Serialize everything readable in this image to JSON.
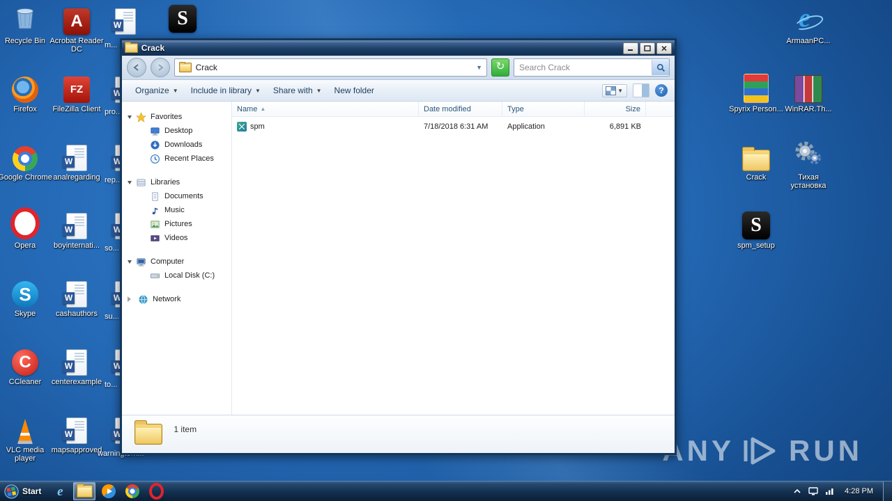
{
  "desktop": {
    "column1": [
      {
        "label": "Recycle Bin"
      },
      {
        "label": "Firefox"
      },
      {
        "label": "Google Chrome"
      },
      {
        "label": "Opera"
      },
      {
        "label": "Skype"
      },
      {
        "label": "CCleaner"
      },
      {
        "label": "VLC media player"
      }
    ],
    "column2": [
      {
        "label": "Acrobat Reader DC"
      },
      {
        "label": "FileZilla Client"
      },
      {
        "label": "analregarding"
      },
      {
        "label": "boyinternati..."
      },
      {
        "label": "cashauthors"
      },
      {
        "label": "centerexample"
      },
      {
        "label": "mapsapproved"
      }
    ],
    "column3_partial_labels": [
      "m...",
      "pro...",
      "rep...",
      "so...",
      "su...",
      "to...",
      "warningtorn..."
    ],
    "right_column": [
      {
        "label": "ArmaanPC..."
      },
      {
        "label": "Spyrix Person..."
      },
      {
        "label": "WinRAR.Th..."
      },
      {
        "label": "Crack"
      },
      {
        "label": "Тихая установка"
      },
      {
        "label": "spm_setup"
      }
    ]
  },
  "window": {
    "title": "Crack",
    "address": "Crack",
    "search_placeholder": "Search Crack",
    "toolbar_items": [
      "Organize",
      "Include in library",
      "Share with",
      "New folder"
    ],
    "sidebar": {
      "groups": [
        {
          "label": "Favorites",
          "children": [
            {
              "label": "Desktop"
            },
            {
              "label": "Downloads"
            },
            {
              "label": "Recent Places"
            }
          ]
        },
        {
          "label": "Libraries",
          "children": [
            {
              "label": "Documents"
            },
            {
              "label": "Music"
            },
            {
              "label": "Pictures"
            },
            {
              "label": "Videos"
            }
          ]
        },
        {
          "label": "Computer",
          "children": [
            {
              "label": "Local Disk (C:)"
            }
          ]
        },
        {
          "label": "Network",
          "children": []
        }
      ]
    },
    "columns": [
      "Name",
      "Date modified",
      "Type",
      "Size"
    ],
    "files": [
      {
        "name": "spm",
        "date_modified": "7/18/2018 6:31 AM",
        "type": "Application",
        "size": "6,891 KB"
      }
    ],
    "status": "1 item"
  },
  "taskbar": {
    "start_label": "Start",
    "time": "4:28 PM"
  },
  "watermark": {
    "left": "ANY",
    "right": "RUN"
  },
  "colors": {
    "accent_green_refresh": "#2fae3a",
    "titlebar_blue": "#1c3f68",
    "desktop_blue": "#2468b4"
  }
}
